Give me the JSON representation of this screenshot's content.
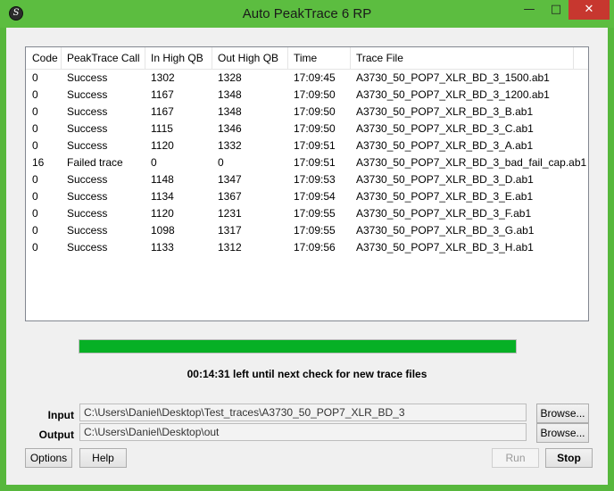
{
  "window": {
    "title": "Auto PeakTrace 6 RP",
    "icon": "peaktrace-app-icon",
    "controls": {
      "minimize": "—",
      "maximize": "□",
      "close": "✕"
    }
  },
  "table": {
    "columns": [
      "Code",
      "PeakTrace Call",
      "In High QB",
      "Out High QB",
      "Time",
      "Trace File"
    ],
    "rows": [
      [
        "0",
        "Success",
        "1302",
        "1328",
        "17:09:45",
        "A3730_50_POP7_XLR_BD_3_1500.ab1"
      ],
      [
        "0",
        "Success",
        "1167",
        "1348",
        "17:09:50",
        "A3730_50_POP7_XLR_BD_3_1200.ab1"
      ],
      [
        "0",
        "Success",
        "1167",
        "1348",
        "17:09:50",
        "A3730_50_POP7_XLR_BD_3_B.ab1"
      ],
      [
        "0",
        "Success",
        "1115",
        "1346",
        "17:09:50",
        "A3730_50_POP7_XLR_BD_3_C.ab1"
      ],
      [
        "0",
        "Success",
        "1120",
        "1332",
        "17:09:51",
        "A3730_50_POP7_XLR_BD_3_A.ab1"
      ],
      [
        "16",
        "Failed trace",
        "0",
        "0",
        "17:09:51",
        "A3730_50_POP7_XLR_BD_3_bad_fail_cap.ab1"
      ],
      [
        "0",
        "Success",
        "1148",
        "1347",
        "17:09:53",
        "A3730_50_POP7_XLR_BD_3_D.ab1"
      ],
      [
        "0",
        "Success",
        "1134",
        "1367",
        "17:09:54",
        "A3730_50_POP7_XLR_BD_3_E.ab1"
      ],
      [
        "0",
        "Success",
        "1120",
        "1231",
        "17:09:55",
        "A3730_50_POP7_XLR_BD_3_F.ab1"
      ],
      [
        "0",
        "Success",
        "1098",
        "1317",
        "17:09:55",
        "A3730_50_POP7_XLR_BD_3_G.ab1"
      ],
      [
        "0",
        "Success",
        "1133",
        "1312",
        "17:09:56",
        "A3730_50_POP7_XLR_BD_3_H.ab1"
      ]
    ]
  },
  "progress": {
    "percent": 100,
    "color": "#06b025"
  },
  "status_text": "00:14:31 left until next check for new trace files",
  "input": {
    "label": "Input",
    "value": "C:\\Users\\Daniel\\Desktop\\Test_traces\\A3730_50_POP7_XLR_BD_3",
    "browse_label": "Browse..."
  },
  "output": {
    "label": "Output",
    "value": "C:\\Users\\Daniel\\Desktop\\out",
    "browse_label": "Browse..."
  },
  "buttons": {
    "options": "Options",
    "help": "Help",
    "run": "Run",
    "stop": "Stop"
  },
  "colors": {
    "frame": "#5cbd40",
    "close": "#c7372f"
  }
}
